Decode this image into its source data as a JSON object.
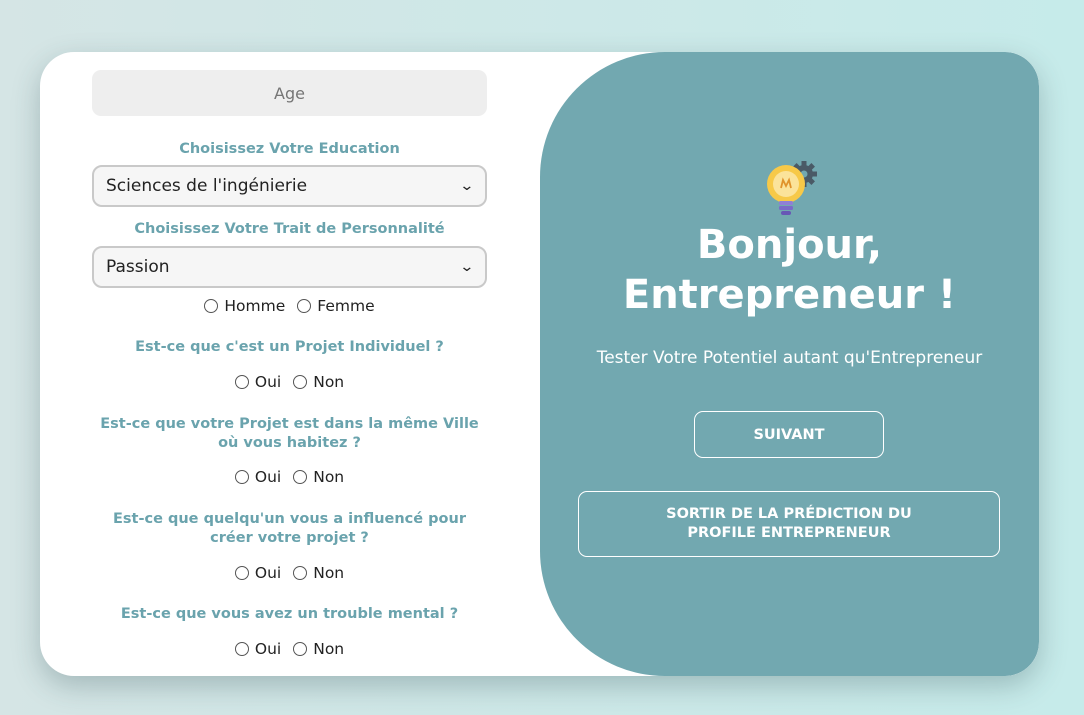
{
  "form": {
    "age_placeholder": "Age",
    "education_label": "Choisissez Votre Education",
    "education_selected": "Sciences de l'ingénierie",
    "trait_label": "Choisissez Votre Trait de Personnalité",
    "trait_selected": "Passion",
    "gender": {
      "options": [
        "Homme",
        "Femme"
      ]
    },
    "questions": [
      {
        "label": "Est-ce que c'est un Projet Individuel ?",
        "options": [
          "Oui",
          "Non"
        ]
      },
      {
        "label": "Est-ce que votre Projet est dans la même Ville où vous habitez ?",
        "options": [
          "Oui",
          "Non"
        ]
      },
      {
        "label": "Est-ce que quelqu'un vous a influencé pour créer votre projet ?",
        "options": [
          "Oui",
          "Non"
        ]
      },
      {
        "label": "Est-ce que vous avez un trouble mental ?",
        "options": [
          "Oui",
          "Non"
        ]
      }
    ]
  },
  "hero": {
    "icon": "lightbulb-gear-icon",
    "title_line1": "Bonjour,",
    "title_line2": "Entrepreneur !",
    "subtitle": "Tester Votre Potentiel autant qu'Entrepreneur",
    "next_button": "SUIVANT",
    "exit_button": "SORTIR DE LA PRÉDICTION DU PROFILE ENTREPRENEUR"
  },
  "colors": {
    "accent": "#72a8b0",
    "label": "#6aa3ad",
    "card": "#ffffff"
  }
}
